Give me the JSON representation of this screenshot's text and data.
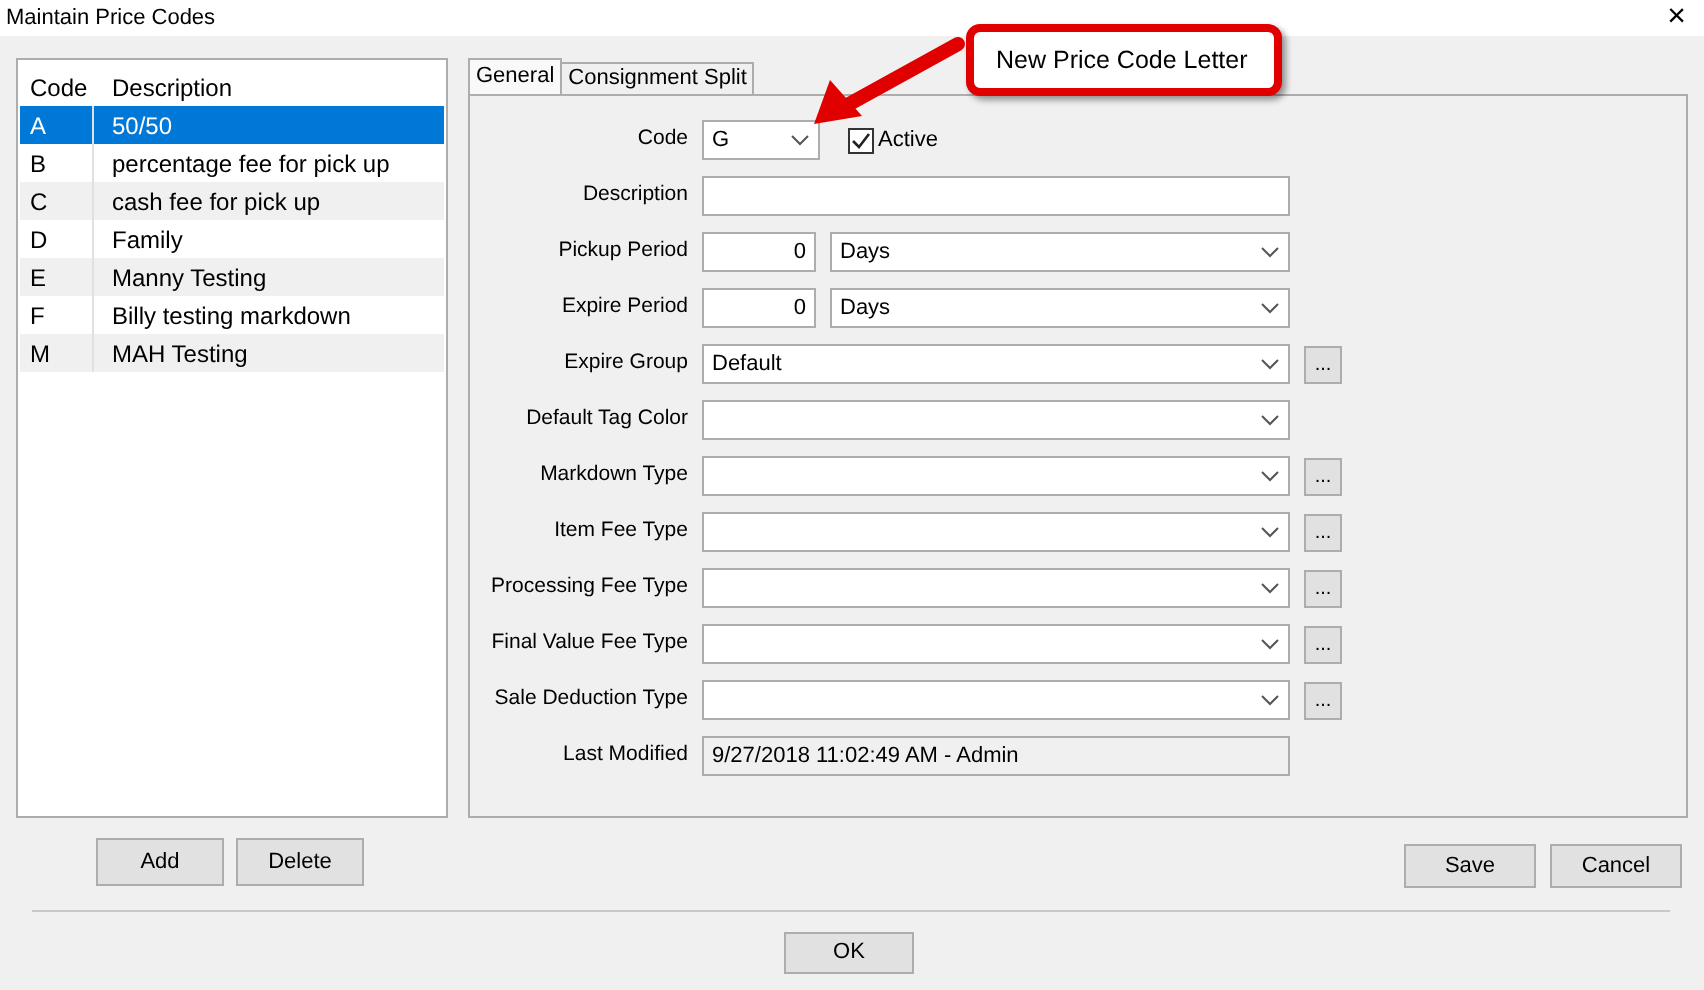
{
  "window": {
    "title": "Maintain Price Codes",
    "close": "×"
  },
  "list": {
    "columns": [
      "Code",
      "Description"
    ],
    "rows": [
      {
        "code": "A",
        "description": "50/50",
        "selected": true
      },
      {
        "code": "B",
        "description": "percentage fee for pick up",
        "selected": false
      },
      {
        "code": "C",
        "description": "cash fee for pick up",
        "selected": false
      },
      {
        "code": "D",
        "description": "Family",
        "selected": false
      },
      {
        "code": "E",
        "description": "Manny Testing",
        "selected": false
      },
      {
        "code": "F",
        "description": "Billy testing markdown",
        "selected": false
      },
      {
        "code": "M",
        "description": "MAH Testing",
        "selected": false
      }
    ]
  },
  "tabs": [
    {
      "label": "General",
      "selected": true
    },
    {
      "label": "Consignment Split",
      "selected": false
    }
  ],
  "fields": [
    {
      "label": "Code",
      "kind": "code",
      "value": "G",
      "checkbox": {
        "label": "Active",
        "checked": true
      }
    },
    {
      "label": "Description",
      "kind": "text"
    },
    {
      "label": "Pickup Period",
      "kind": "period",
      "value": "0",
      "unit": "Days"
    },
    {
      "label": "Expire Period",
      "kind": "period",
      "value": "0",
      "unit": "Days"
    },
    {
      "label": "Expire Group",
      "kind": "combo",
      "value": "Default",
      "more": "..."
    },
    {
      "label": "Default Tag Color",
      "kind": "combo"
    },
    {
      "label": "Markdown Type",
      "kind": "combo",
      "more": "..."
    },
    {
      "label": "Item Fee Type",
      "kind": "combo",
      "more": "..."
    },
    {
      "label": "Processing Fee Type",
      "kind": "combo",
      "more": "..."
    },
    {
      "label": "Final Value Fee Type",
      "kind": "combo",
      "more": "..."
    },
    {
      "label": "Sale Deduction Type",
      "kind": "combo",
      "more": "..."
    },
    {
      "label": "Last Modified",
      "kind": "readonly",
      "value": "9/27/2018 11:02:49 AM - Admin"
    }
  ],
  "list_buttons": [
    "Add",
    "Delete"
  ],
  "form_buttons": [
    "Save",
    "Cancel"
  ],
  "ok_button": "OK",
  "callout": {
    "text": "New Price Code Letter"
  }
}
